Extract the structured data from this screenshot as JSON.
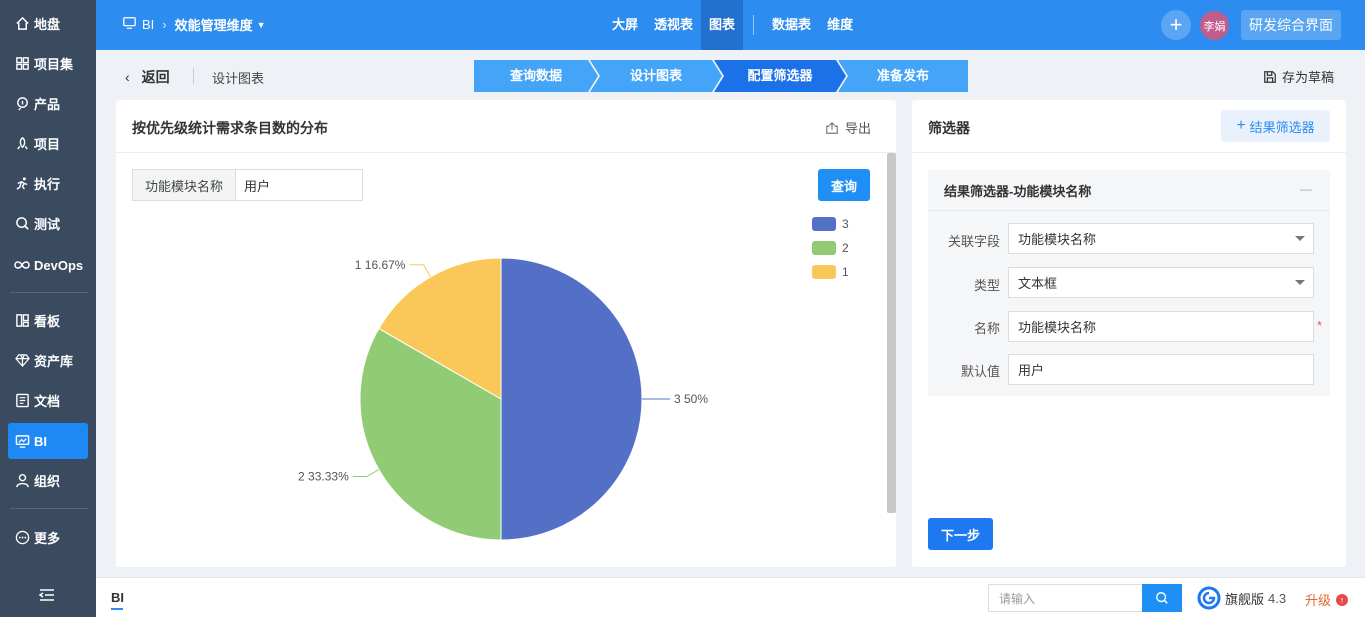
{
  "sidebar": {
    "items": [
      {
        "label": "地盘",
        "icon": "home-icon"
      },
      {
        "label": "项目集",
        "icon": "grid-icon"
      },
      {
        "label": "产品",
        "icon": "product-icon"
      },
      {
        "label": "项目",
        "icon": "project-icon"
      },
      {
        "label": "执行",
        "icon": "run-icon"
      },
      {
        "label": "测试",
        "icon": "test-icon"
      },
      {
        "label": "DevOps",
        "icon": "infinity-icon"
      },
      {
        "label": "看板",
        "icon": "kanban-icon"
      },
      {
        "label": "资产库",
        "icon": "diamond-icon"
      },
      {
        "label": "文档",
        "icon": "doc-icon"
      },
      {
        "label": "BI",
        "icon": "monitor-icon",
        "active": true
      },
      {
        "label": "组织",
        "icon": "user-icon"
      },
      {
        "label": "更多",
        "icon": "more-icon"
      }
    ]
  },
  "topbar": {
    "module": "BI",
    "title": "效能管理维度",
    "nav": [
      "大屏",
      "透视表",
      "图表",
      "数据表",
      "维度"
    ],
    "active_nav": "图表",
    "avatar_text": "李娟",
    "workspace": "研发综合界面"
  },
  "subheader": {
    "back": "返回",
    "page_title": "设计图表",
    "steps": [
      "查询数据",
      "设计图表",
      "配置筛选器",
      "准备发布"
    ],
    "active_step": 2,
    "save_draft": "存为草稿"
  },
  "chart_panel": {
    "title": "按优先级统计需求条目数的分布",
    "export": "导出",
    "filter_label": "功能模块名称",
    "filter_value": "用户",
    "query_button": "查询"
  },
  "chart_data": {
    "type": "pie",
    "title": "",
    "slices": [
      {
        "name": "3",
        "value": 50,
        "label": "3 50%",
        "color": "#5470c6"
      },
      {
        "name": "2",
        "value": 33.33,
        "label": "2 33.33%",
        "color": "#91cc75"
      },
      {
        "name": "1",
        "value": 16.67,
        "label": "1 16.67%",
        "color": "#fac858"
      }
    ],
    "legend": [
      "3",
      "2",
      "1"
    ],
    "legend_position": "top-right"
  },
  "filter_panel": {
    "title": "筛选器",
    "add_button": "结果筛选器",
    "card_title": "结果筛选器-功能模块名称",
    "collapse": "—",
    "fields": [
      {
        "label": "关联字段",
        "value": "功能模块名称",
        "dropdown": true,
        "required": false
      },
      {
        "label": "类型",
        "value": "文本框",
        "dropdown": true,
        "required": false
      },
      {
        "label": "名称",
        "value": "功能模块名称",
        "dropdown": false,
        "required": true
      },
      {
        "label": "默认值",
        "value": "用户",
        "dropdown": false,
        "required": false
      }
    ],
    "required_mark": "*",
    "next_button": "下一步"
  },
  "bottombar": {
    "tab": "BI",
    "search_placeholder": "请输入",
    "edition": "旗舰版",
    "version": "4.3",
    "upgrade": "升级"
  },
  "colors": {
    "primary": "#2d8cf0",
    "sidebar": "#3a4a5f"
  }
}
